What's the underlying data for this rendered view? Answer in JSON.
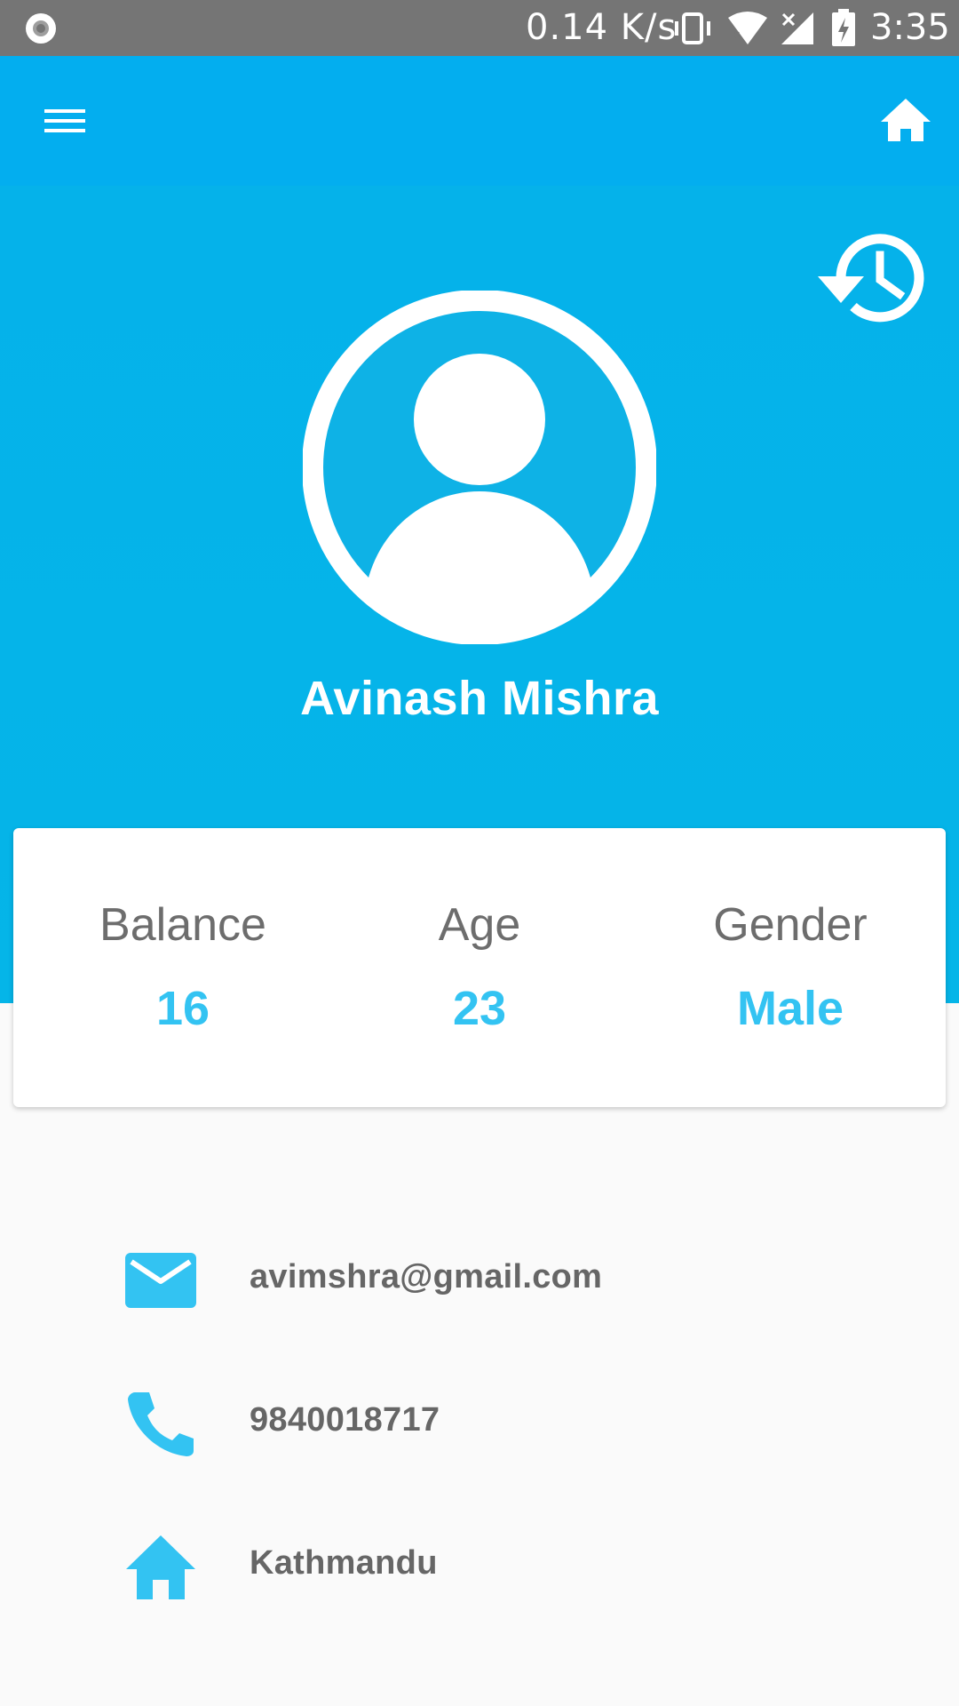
{
  "status_bar": {
    "net_speed": "0.14 K/s",
    "time": "3:35",
    "icons": [
      "record-icon",
      "vibrate-icon",
      "wifi-icon",
      "signal-icon",
      "battery-charging-icon"
    ]
  },
  "app_bar": {
    "menu_icon": "hamburger-menu-icon",
    "home_icon": "home-icon"
  },
  "profile": {
    "name": "Avinash Mishra",
    "history_icon": "history-icon",
    "avatar_icon": "account-circle-icon"
  },
  "stats": {
    "balance_label": "Balance",
    "balance_value": "16",
    "age_label": "Age",
    "age_value": "23",
    "gender_label": "Gender",
    "gender_value": "Male"
  },
  "contact": {
    "email": "avimshra@gmail.com",
    "phone": "9840018717",
    "address": "Kathmandu"
  },
  "colors": {
    "app_bar": "#03aeef",
    "header": "#05b2ea",
    "accent": "#33c3f2",
    "status_bar": "#757575",
    "label_text": "#6d6d6d",
    "contact_text": "#666666",
    "background": "#fafafa"
  }
}
